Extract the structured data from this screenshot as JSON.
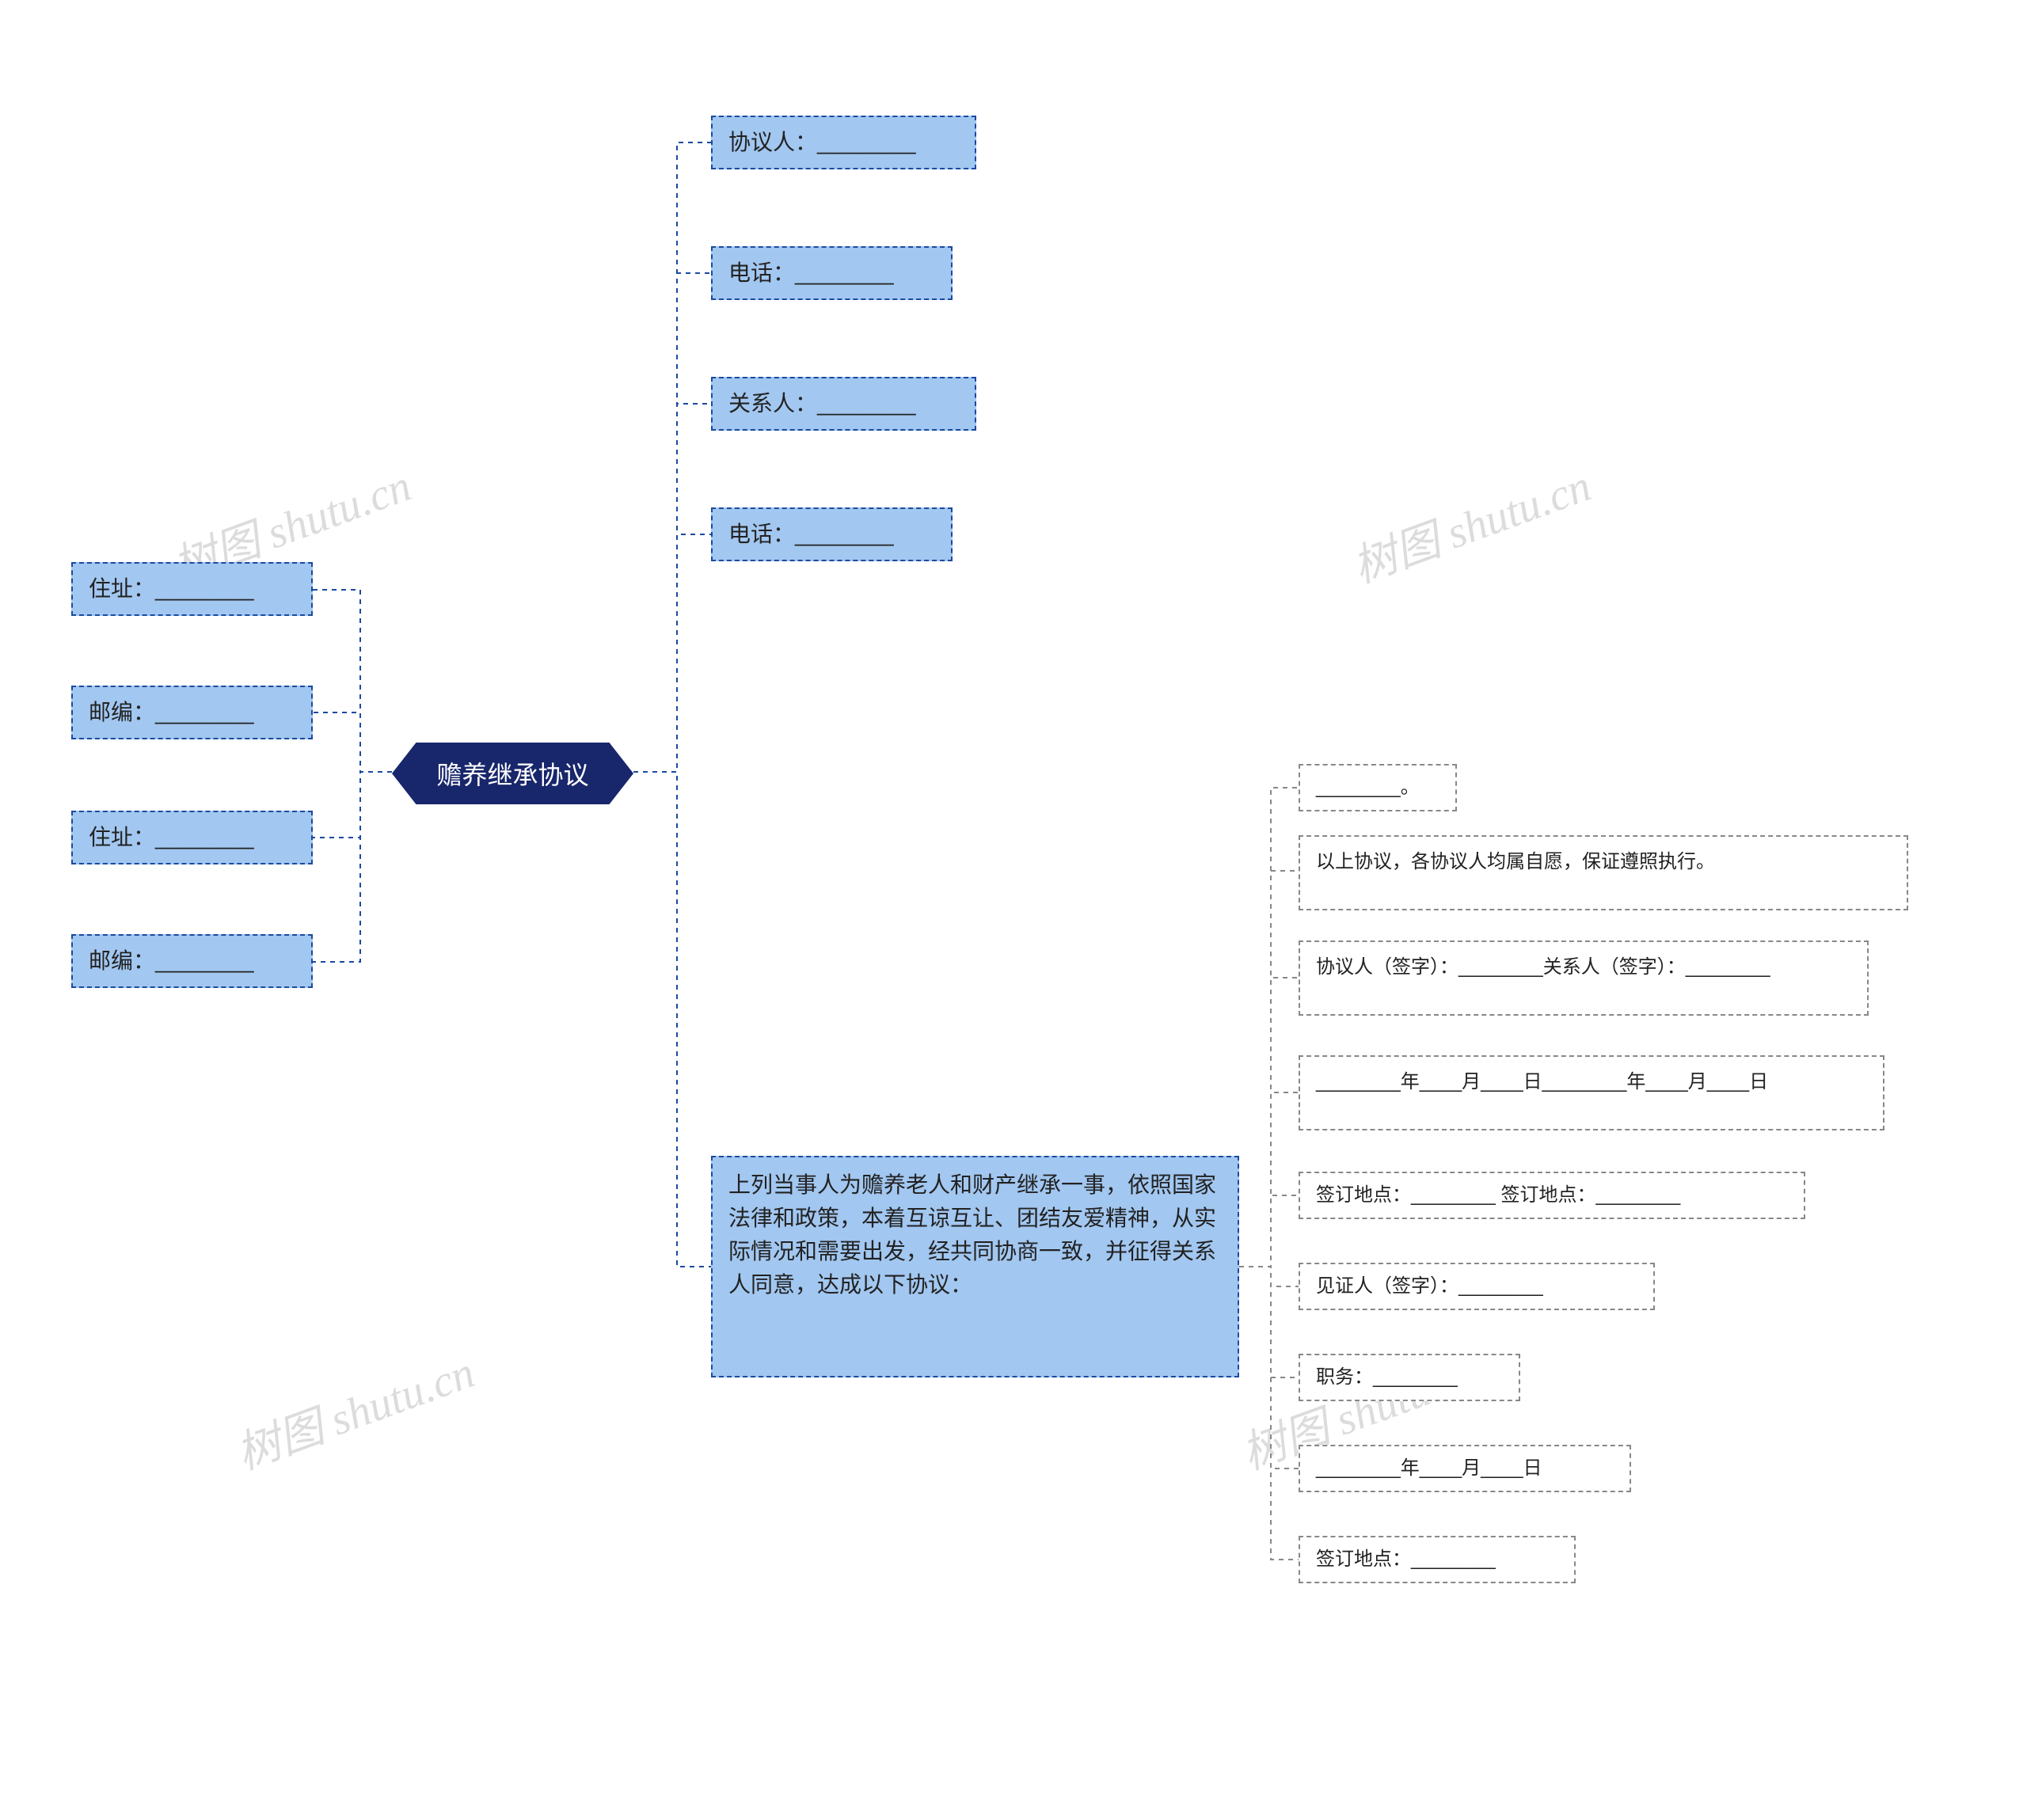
{
  "root": {
    "label": "赡养继承协议"
  },
  "left": {
    "items": [
      {
        "label": "住址：________"
      },
      {
        "label": "邮编：________"
      },
      {
        "label": "住址：________"
      },
      {
        "label": "邮编：________"
      }
    ]
  },
  "right_top": {
    "items": [
      {
        "label": "协议人：________"
      },
      {
        "label": "电话：________"
      },
      {
        "label": "关系人：________"
      },
      {
        "label": "电话：________"
      }
    ]
  },
  "right_body": {
    "label": "上列当事人为赡养老人和财产继承一事，依照国家法律和政策，本着互谅互让、团结友爱精神，从实际情况和需要出发，经共同协商一致，并征得关系人同意，达成以下协议："
  },
  "sub": {
    "items": [
      {
        "label": "________。"
      },
      {
        "label": "以上协议，各协议人均属自愿，保证遵照执行。"
      },
      {
        "label": "协议人（签字）：________关系人（签字）：________"
      },
      {
        "label": "________年____月____日________年____月____日"
      },
      {
        "label": "签订地点：________ 签订地点：________"
      },
      {
        "label": "见证人（签字）：________"
      },
      {
        "label": "职务：________"
      },
      {
        "label": "________年____月____日"
      },
      {
        "label": "签订地点：________"
      }
    ]
  },
  "watermark": "树图 shutu.cn",
  "colors": {
    "dashBlue": "#1a4aa0",
    "dashGray": "#888888"
  }
}
